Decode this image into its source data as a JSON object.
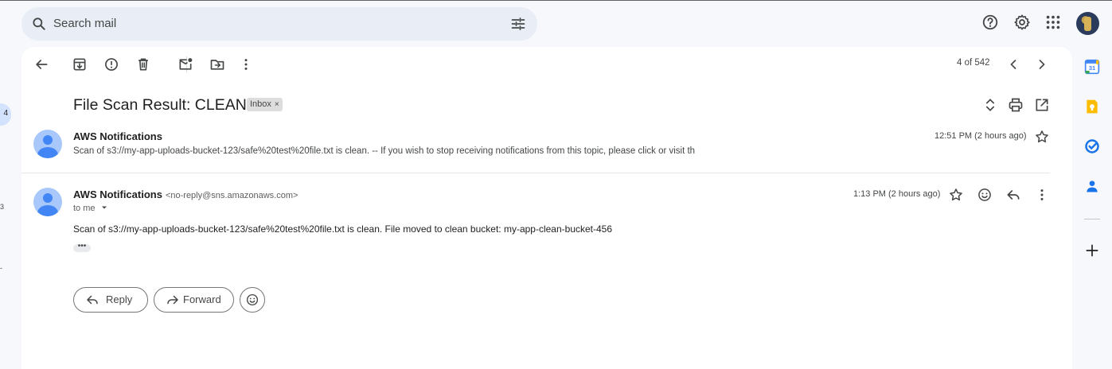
{
  "search": {
    "placeholder": "Search mail"
  },
  "rail": {
    "badge": "4",
    "mark1": "3",
    "mark2": "-"
  },
  "toolbar": {
    "pager": "4 of 542"
  },
  "thread": {
    "subject": "File Scan Result: CLEAN",
    "label_chip": "Inbox",
    "label_chip_close": "×"
  },
  "messages": [
    {
      "sender": "AWS Notifications",
      "snippet": "Scan of s3://my-app-uploads-bucket-123/safe%20test%20file.txt is clean. -- If you wish to stop receiving notifications from this topic, please click or visit th",
      "time": "12:51 PM (2 hours ago)"
    },
    {
      "sender": "AWS Notifications",
      "email": "<no-reply@sns.amazonaws.com>",
      "to": "to me",
      "time": "1:13 PM (2 hours ago)",
      "body": "Scan of s3://my-app-uploads-bucket-123/safe%20test%20file.txt is clean. File moved to clean bucket: my-app-clean-bucket-456",
      "trimmed": "•••"
    }
  ],
  "actions": {
    "reply": "Reply",
    "forward": "Forward"
  },
  "colors": {
    "accent": "#0b57d0",
    "search_bg": "#e9eef6",
    "page_bg": "#f6f8fc"
  }
}
